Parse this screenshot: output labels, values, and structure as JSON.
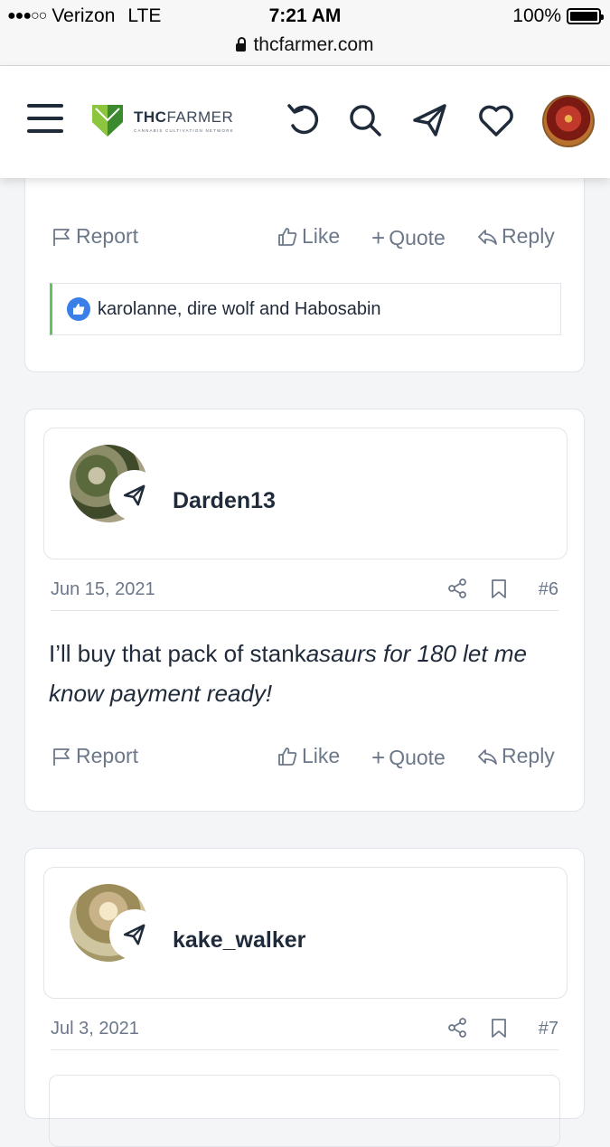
{
  "status_bar": {
    "signal": "●●●○○",
    "carrier": "Verizon",
    "network": "LTE",
    "time": "7:21 AM",
    "battery": "100%",
    "url": "thcfarmer.com"
  },
  "header": {
    "logo_main_bold": "THC",
    "logo_main_rest": "FARMER",
    "logo_sub": "CANNABIS CULTIVATION NETWORK",
    "icons": [
      "menu-icon",
      "refresh-icon",
      "search-icon",
      "send-icon",
      "heart-icon"
    ]
  },
  "actions": {
    "report": "Report",
    "like": "Like",
    "quote": "Quote",
    "reply": "Reply"
  },
  "posts": [
    {
      "reactions": "karolanne, dire wolf and Habosabin"
    },
    {
      "username": "Darden13",
      "date": "Jun 15, 2021",
      "number": "#6",
      "message_plain": "I’ll buy that pack of stank",
      "message_italic": "asaurs for 180 let me know payment ready!"
    },
    {
      "username": "kake_walker",
      "date": "Jul 3, 2021",
      "number": "#7"
    }
  ],
  "colors": {
    "accent_green": "#5cc55c",
    "like_blue": "#3a7ee8",
    "text_dark": "#1f2a3a",
    "text_muted": "#6c7889"
  }
}
